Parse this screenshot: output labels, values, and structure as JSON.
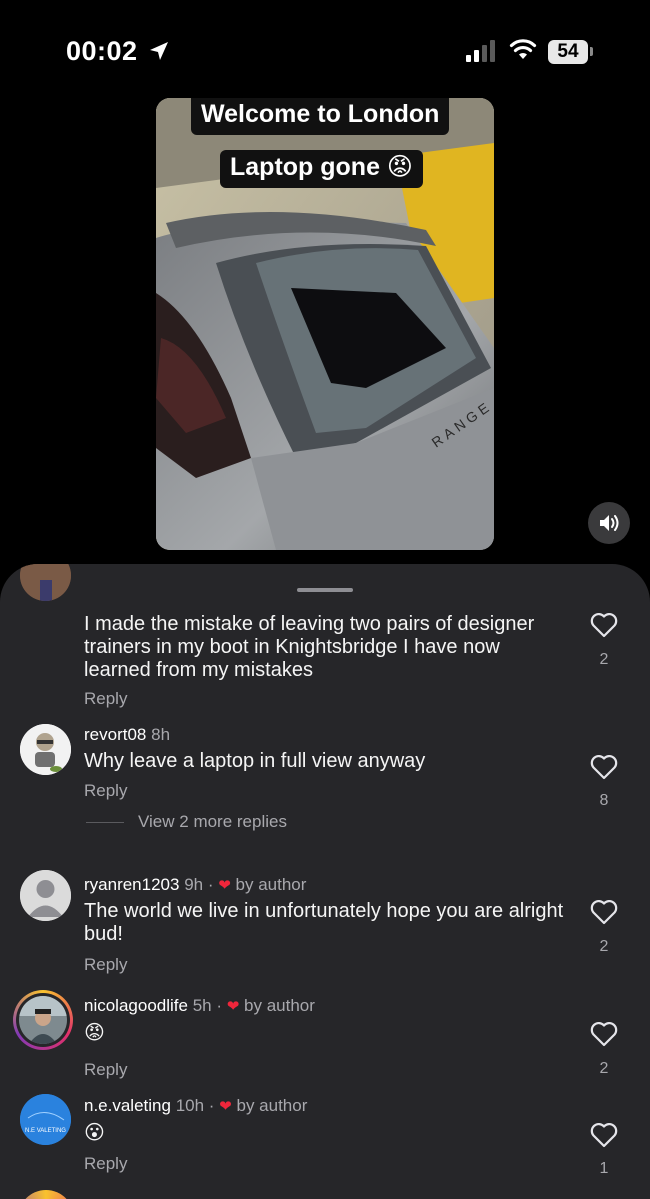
{
  "status_bar": {
    "time": "00:02",
    "battery": "54"
  },
  "video": {
    "caption_1": "Welcome to London",
    "caption_2": "Laptop gone 😡"
  },
  "comments": [
    {
      "username": "",
      "time": "",
      "text": "I made the mistake of leaving two pairs of designer trainers in my boot in Knightsbridge I have now learned from my mistakes",
      "reply": "Reply",
      "likes": "2"
    },
    {
      "username": "revort08",
      "time": "8h",
      "text": "Why leave a laptop in full view anyway",
      "reply": "Reply",
      "likes": "8",
      "view_more": "View 2 more replies"
    },
    {
      "username": "ryanren1203",
      "time": "9h",
      "liked_by": "by author",
      "text": "The world we live in unfortunately hope you are alright bud!",
      "reply": "Reply",
      "likes": "2"
    },
    {
      "username": "nicolagoodlife",
      "time": "5h",
      "liked_by": "by author",
      "text": "😡",
      "reply": "Reply",
      "likes": "2"
    },
    {
      "username": "n.e.valeting",
      "time": "10h",
      "liked_by": "by author",
      "text": "😮",
      "reply": "Reply",
      "likes": "1",
      "avatar_text": "N.E VALETING"
    }
  ],
  "colors": {
    "sheet": "#262629",
    "heart_red": "#f0263b",
    "muted": "#a8a8ad"
  },
  "icons": [
    "location-arrow-icon",
    "signal-icon",
    "wifi-icon",
    "battery-icon",
    "speaker-icon",
    "heart-icon"
  ]
}
